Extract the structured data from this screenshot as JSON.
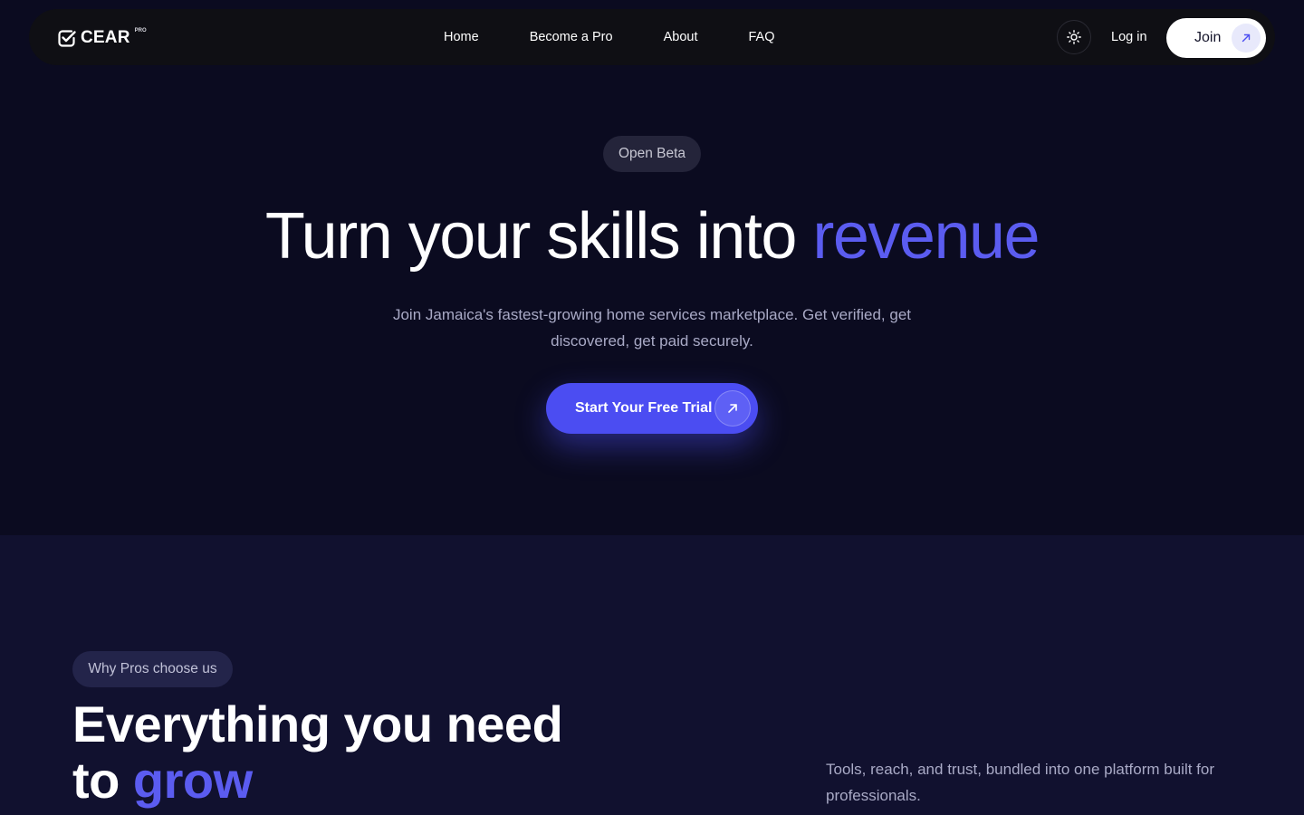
{
  "colors": {
    "accent": "#5b5cf0",
    "cta_bg": "#4b4df2",
    "hero_bg": "#0b0b20",
    "section_bg": "#11112f",
    "nav_bg": "#0f0f14"
  },
  "nav": {
    "logo_text": "CEAR",
    "logo_sup": "PRO",
    "logo_icon": "check-badge-icon",
    "links": [
      "Home",
      "Become a Pro",
      "About",
      "FAQ"
    ],
    "theme_icon": "sun-icon",
    "login_label": "Log in",
    "join_label": "Join",
    "join_icon": "arrow-up-right-icon"
  },
  "hero": {
    "badge": "Open Beta",
    "title_main": "Turn your skills into ",
    "title_accent": "revenue",
    "subtitle": "Join Jamaica's fastest-growing home services marketplace. Get verified, get discovered, get paid securely.",
    "cta_label": "Start Your Free Trial",
    "cta_icon": "arrow-up-right-icon"
  },
  "features": {
    "badge": "Why Pros choose us",
    "title_line1": "Everything you need",
    "title_line2_main": "to ",
    "title_line2_accent": "grow",
    "description": "Tools, reach, and trust, bundled into one platform built for professionals."
  }
}
